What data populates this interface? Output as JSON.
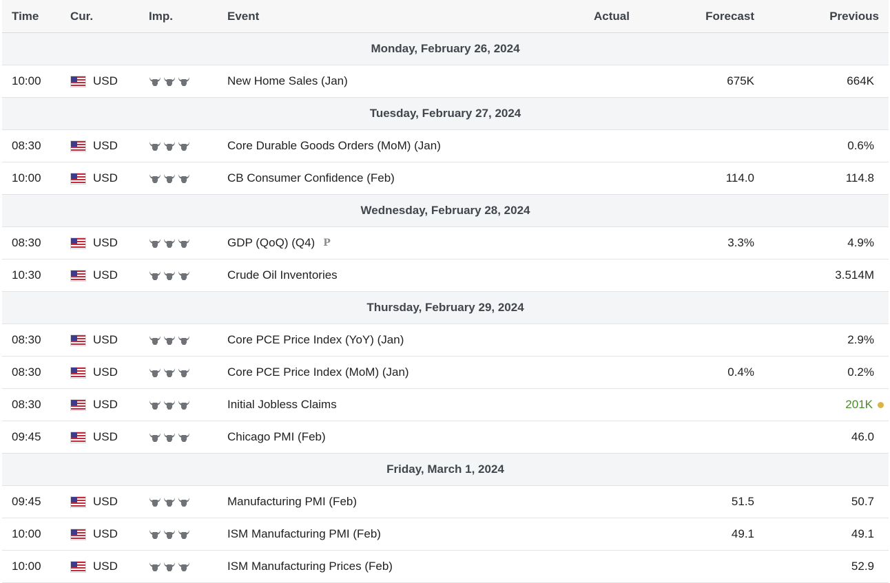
{
  "header": {
    "time": "Time",
    "currency": "Cur.",
    "importance": "Imp.",
    "event": "Event",
    "actual": "Actual",
    "forecast": "Forecast",
    "previous": "Previous"
  },
  "icons": {
    "flag": "us-flag-icon",
    "importance": "bull-icon"
  },
  "colors": {
    "positive": "#4b8a2d",
    "dot": "#dcb443",
    "day_row_bg": "#f4f5f6"
  },
  "days": [
    {
      "date": "Monday, February 26, 2024",
      "events": [
        {
          "time": "10:00",
          "currency": "USD",
          "importance": 3,
          "event": "New Home Sales (Jan)",
          "actual": "",
          "forecast": "675K",
          "previous": "664K"
        }
      ]
    },
    {
      "date": "Tuesday, February 27, 2024",
      "events": [
        {
          "time": "08:30",
          "currency": "USD",
          "importance": 3,
          "event": "Core Durable Goods Orders (MoM) (Jan)",
          "actual": "",
          "forecast": "",
          "previous": "0.6%"
        },
        {
          "time": "10:00",
          "currency": "USD",
          "importance": 3,
          "event": "CB Consumer Confidence (Feb)",
          "actual": "",
          "forecast": "114.0",
          "previous": "114.8"
        }
      ]
    },
    {
      "date": "Wednesday, February 28, 2024",
      "events": [
        {
          "time": "08:30",
          "currency": "USD",
          "importance": 3,
          "event": "GDP (QoQ) (Q4)",
          "prelim": "P",
          "actual": "",
          "forecast": "3.3%",
          "previous": "4.9%"
        },
        {
          "time": "10:30",
          "currency": "USD",
          "importance": 3,
          "event": "Crude Oil Inventories",
          "actual": "",
          "forecast": "",
          "previous": "3.514M"
        }
      ]
    },
    {
      "date": "Thursday, February 29, 2024",
      "events": [
        {
          "time": "08:30",
          "currency": "USD",
          "importance": 3,
          "event": "Core PCE Price Index (YoY) (Jan)",
          "actual": "",
          "forecast": "",
          "previous": "2.9%"
        },
        {
          "time": "08:30",
          "currency": "USD",
          "importance": 3,
          "event": "Core PCE Price Index (MoM) (Jan)",
          "actual": "",
          "forecast": "0.4%",
          "previous": "0.2%"
        },
        {
          "time": "08:30",
          "currency": "USD",
          "importance": 3,
          "event": "Initial Jobless Claims",
          "actual": "",
          "forecast": "",
          "previous": "201K",
          "previous_positive": true,
          "revised_dot": true
        },
        {
          "time": "09:45",
          "currency": "USD",
          "importance": 3,
          "event": "Chicago PMI (Feb)",
          "actual": "",
          "forecast": "",
          "previous": "46.0"
        }
      ]
    },
    {
      "date": "Friday, March 1, 2024",
      "events": [
        {
          "time": "09:45",
          "currency": "USD",
          "importance": 3,
          "event": "Manufacturing PMI (Feb)",
          "actual": "",
          "forecast": "51.5",
          "previous": "50.7"
        },
        {
          "time": "10:00",
          "currency": "USD",
          "importance": 3,
          "event": "ISM Manufacturing PMI (Feb)",
          "actual": "",
          "forecast": "49.1",
          "previous": "49.1"
        },
        {
          "time": "10:00",
          "currency": "USD",
          "importance": 3,
          "event": "ISM Manufacturing Prices (Feb)",
          "actual": "",
          "forecast": "",
          "previous": "52.9"
        }
      ]
    }
  ]
}
